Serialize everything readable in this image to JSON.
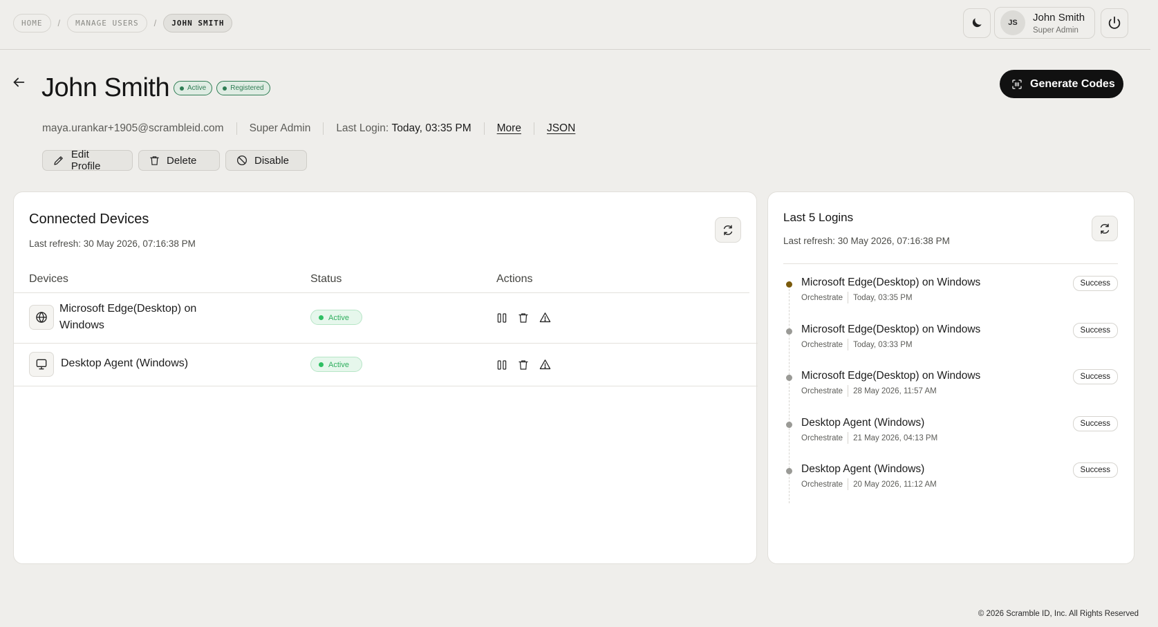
{
  "breadcrumb": [
    "HOME",
    "MANAGE USERS",
    "JOHN SMITH"
  ],
  "user_menu": {
    "initials": "JS",
    "name": "John Smith",
    "role": "Super Admin"
  },
  "profile": {
    "name": "John Smith",
    "badges": [
      "Active",
      "Registered"
    ],
    "email": "maya.urankar+1905@scrambleid.com",
    "role": "Super Admin",
    "last_login_label": "Last Login:",
    "last_login_value": "Today, 03:35 PM",
    "more_link": "More",
    "json_link": "JSON"
  },
  "generate_codes_label": "Generate Codes",
  "profile_actions": {
    "edit": "Edit Profile",
    "delete": "Delete",
    "disable": "Disable"
  },
  "devices_card": {
    "title": "Connected Devices",
    "last_refresh": "Last refresh: 30 May 2026, 07:16:38 PM",
    "columns": [
      "Devices",
      "Status",
      "Actions"
    ],
    "rows": [
      {
        "name_line1": "Microsoft Edge(Desktop) on",
        "name_line2": "Windows",
        "icon": "globe-icon",
        "status": "Active"
      },
      {
        "name_line1": "Desktop Agent (Windows)",
        "name_line2": "",
        "icon": "monitor-icon",
        "status": "Active"
      }
    ]
  },
  "logins_card": {
    "title": "Last 5 Logins",
    "last_refresh": "Last refresh: 30 May 2026, 07:16:38 PM",
    "items": [
      {
        "name": "Microsoft Edge(Desktop) on Windows",
        "app": "Orchestrate",
        "time": "Today, 03:35 PM",
        "result": "Success"
      },
      {
        "name": "Microsoft Edge(Desktop) on Windows",
        "app": "Orchestrate",
        "time": "Today, 03:33 PM",
        "result": "Success"
      },
      {
        "name": "Microsoft Edge(Desktop) on Windows",
        "app": "Orchestrate",
        "time": "28 May 2026, 11:57 AM",
        "result": "Success"
      },
      {
        "name": "Desktop Agent (Windows)",
        "app": "Orchestrate",
        "time": "21 May 2026, 04:13 PM",
        "result": "Success"
      },
      {
        "name": "Desktop Agent (Windows)",
        "app": "Orchestrate",
        "time": "20 May 2026, 11:12 AM",
        "result": "Success"
      }
    ]
  },
  "footer": "© 2026 Scramble ID, Inc. All Rights Reserved",
  "colors": {
    "active_green": "#2fae5e",
    "badge_green": "#2f7d54",
    "primary_button": "#111111",
    "latest_dot": "#7a5a0c"
  }
}
